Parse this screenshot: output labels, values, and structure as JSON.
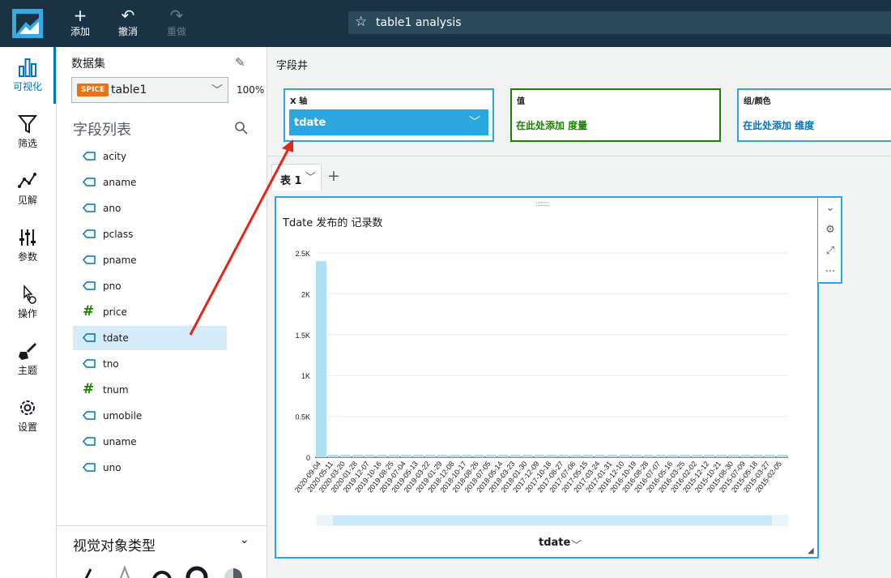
{
  "header": {
    "add_label": "添加",
    "undo_label": "撤消",
    "redo_label": "重做",
    "analysis_title": "table1 analysis"
  },
  "rail": [
    {
      "label": "可视化",
      "icon": "bar-chart-icon"
    },
    {
      "label": "筛选",
      "icon": "filter-icon"
    },
    {
      "label": "见解",
      "icon": "insights-icon"
    },
    {
      "label": "参数",
      "icon": "sliders-icon"
    },
    {
      "label": "操作",
      "icon": "pointer-gear-icon"
    },
    {
      "label": "主题",
      "icon": "brush-icon"
    },
    {
      "label": "设置",
      "icon": "gear-icon"
    }
  ],
  "dataset": {
    "label": "数据集",
    "badge": "SPICE",
    "name": "table1",
    "percent": "100%"
  },
  "field_list": {
    "title": "字段列表",
    "fields": [
      {
        "name": "acity",
        "kind": "dimension"
      },
      {
        "name": "aname",
        "kind": "dimension"
      },
      {
        "name": "ano",
        "kind": "dimension"
      },
      {
        "name": "pclass",
        "kind": "dimension"
      },
      {
        "name": "pname",
        "kind": "dimension"
      },
      {
        "name": "pno",
        "kind": "dimension"
      },
      {
        "name": "price",
        "kind": "measure"
      },
      {
        "name": "tdate",
        "kind": "dimension",
        "selected": true
      },
      {
        "name": "tno",
        "kind": "dimension"
      },
      {
        "name": "tnum",
        "kind": "measure"
      },
      {
        "name": "umobile",
        "kind": "dimension"
      },
      {
        "name": "uname",
        "kind": "dimension"
      },
      {
        "name": "uno",
        "kind": "dimension"
      }
    ]
  },
  "visual_types": {
    "title": "视觉对象类型"
  },
  "field_wells": {
    "label": "字段井",
    "x_axis": {
      "title": "X 轴",
      "field": "tdate",
      "color": "#2ba7e0"
    },
    "value": {
      "title": "值",
      "hint": "在此处添加 度量",
      "color": "#1d8102"
    },
    "group": {
      "title": "组/颜色",
      "hint": "在此处添加 维度",
      "color": "#0073bb"
    }
  },
  "sheet": {
    "tab_label": "表 1"
  },
  "visual": {
    "title": "Tdate 发布的 记录数",
    "x_field": "tdate"
  },
  "colors": {
    "accent": "#2ba7e0",
    "annotation_arrow": "#e8231a",
    "topbar": "#1a3344"
  },
  "chart_data": {
    "type": "bar",
    "title": "Tdate 发布的 记录数",
    "xlabel": "tdate",
    "ylabel": "",
    "ylim": [
      0,
      2500
    ],
    "yticks": [
      "0",
      "0.5K",
      "1K",
      "1.5K",
      "2K",
      "2.5K"
    ],
    "categories": [
      "2020-09-04",
      "2020-05-11",
      "2020-03-20",
      "2020-01-28",
      "2019-12-07",
      "2019-10-16",
      "2019-08-25",
      "2019-07-04",
      "2019-05-13",
      "2019-03-22",
      "2019-01-29",
      "2018-12-08",
      "2018-10-17",
      "2018-08-26",
      "2018-07-05",
      "2018-05-14",
      "2018-03-23",
      "2018-01-30",
      "2017-12-09",
      "2017-10-18",
      "2017-08-27",
      "2017-07-06",
      "2017-05-15",
      "2017-03-24",
      "2017-01-31",
      "2016-12-10",
      "2016-10-19",
      "2016-08-28",
      "2016-07-07",
      "2016-05-16",
      "2016-03-25",
      "2016-02-02",
      "2015-12-12",
      "2015-10-21",
      "2015-08-30",
      "2015-07-09",
      "2015-05-18",
      "2015-03-27",
      "2015-02-05"
    ],
    "series": [
      {
        "values": [
          2400,
          30,
          30,
          30,
          30,
          30,
          30,
          30,
          30,
          30,
          30,
          30,
          30,
          30,
          30,
          30,
          30,
          30,
          30,
          30,
          30,
          30,
          30,
          30,
          30,
          30,
          30,
          30,
          30,
          30,
          30,
          30,
          30,
          30,
          30,
          30,
          30,
          30,
          30
        ]
      }
    ]
  }
}
